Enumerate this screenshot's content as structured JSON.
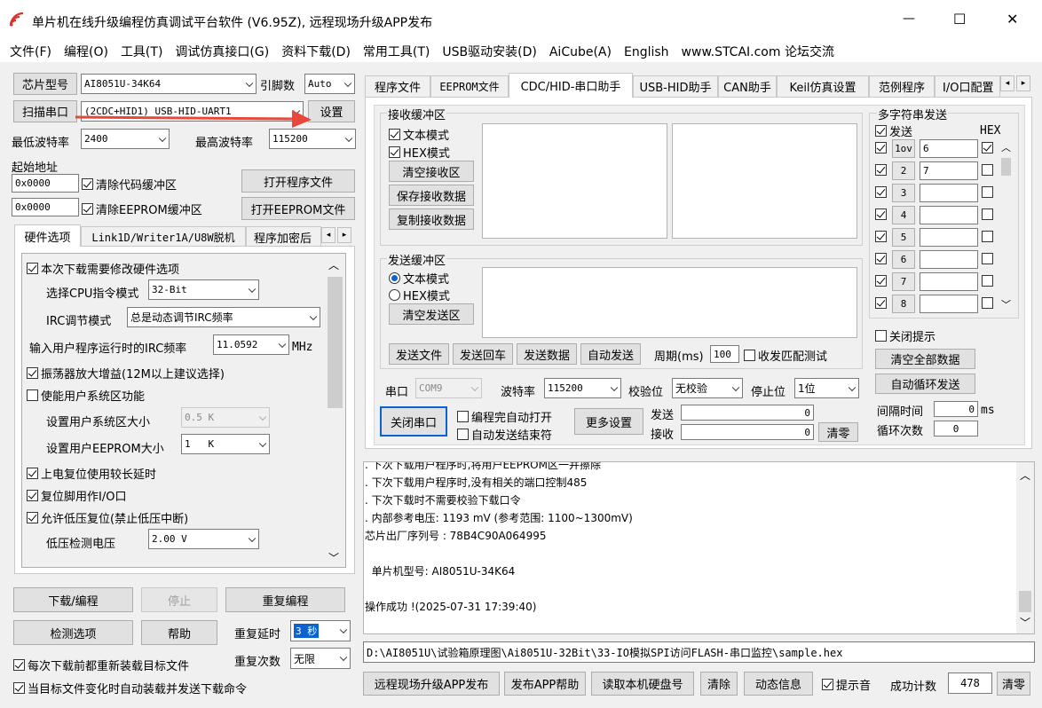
{
  "window": {
    "title": "单片机在线升级编程仿真调试平台软件 (V6.95Z), 远程现场升级APP发布",
    "minimize": "—",
    "maximize": "☐",
    "close": "✕"
  },
  "menu": [
    "文件(F)",
    "编程(O)",
    "工具(T)",
    "调试仿真接口(G)",
    "资料下载(D)",
    "常用工具(T)",
    "USB驱动安装(D)",
    "AiCube(A)",
    "English",
    "www.STCAI.com 论坛交流"
  ],
  "left": {
    "chip_btn": "芯片型号",
    "chip": "AI8051U-34K64",
    "pin_label": "引脚数",
    "pin": "Auto",
    "scan_btn": "扫描串口",
    "port": "(2CDC+HID1) USB-HID-UART1",
    "settings_btn": "设置",
    "min_baud_label": "最低波特率",
    "min_baud": "2400",
    "max_baud_label": "最高波特率",
    "max_baud": "115200",
    "start_addr_label": "起始地址",
    "addr1": "0x0000",
    "clear_code": "清除代码缓冲区",
    "open_prog": "打开程序文件",
    "addr2": "0x0000",
    "clear_eeprom": "清除EEPROM缓冲区",
    "open_eeprom": "打开EEPROM文件",
    "tabs": [
      "硬件选项",
      "Link1D/Writer1A/U8W脱机",
      "程序加密后"
    ],
    "hw": {
      "opt_modify": "本次下载需要修改硬件选项",
      "cpu_mode_label": "选择CPU指令模式",
      "cpu_mode": "32-Bit",
      "irc_mode_label": "IRC调节模式",
      "irc_mode": "总是动态调节IRC频率",
      "irc_freq_label": "输入用户程序运行时的IRC频率",
      "irc_freq": "11.0592",
      "mhz": "MHz",
      "osc_gain": "振荡器放大增益(12M以上建议选择)",
      "user_sys": "使能用户系统区功能",
      "sys_size_label": "设置用户系统区大小",
      "sys_size": "0.5 K",
      "eeprom_size_label": "设置用户EEPROM大小",
      "eeprom_size": "1   K",
      "power_delay": "上电复位使用较长延时",
      "reset_io": "复位脚用作I/O口",
      "lvr": "允许低压复位(禁止低压中断)",
      "lvd_label": "低压检测电压",
      "lvd": "2.00 V"
    },
    "download_btn": "下载/编程",
    "stop_btn": "停止",
    "reprog_btn": "重复编程",
    "check_btn": "检测选项",
    "help_btn": "帮助",
    "delay_label": "重复延时",
    "delay": "3 秒",
    "count_label": "重复次数",
    "count": "无限",
    "reload_each": "每次下载前都重新装载目标文件",
    "auto_reload": "当目标文件变化时自动装载并发送下载命令"
  },
  "right": {
    "tabs": [
      "程序文件",
      "EEPROM文件",
      "CDC/HID-串口助手",
      "USB-HID助手",
      "CAN助手",
      "Keil仿真设置",
      "范例程序",
      "I/O口配置"
    ],
    "rx_group": "接收缓冲区",
    "rx_text": "文本模式",
    "rx_hex": "HEX模式",
    "clear_rx": "清空接收区",
    "save_rx": "保存接收数据",
    "copy_rx": "复制接收数据",
    "tx_group": "发送缓冲区",
    "tx_text": "文本模式",
    "tx_hex": "HEX模式",
    "clear_tx": "清空发送区",
    "send_file": "发送文件",
    "send_enter": "发送回车",
    "send_data": "发送数据",
    "auto_send": "自动发送",
    "period_label": "周期(ms)",
    "period": "100",
    "match_test": "收发匹配测试",
    "port_label": "串口",
    "port": "COM9",
    "baud_label": "波特率",
    "baud": "115200",
    "parity_label": "校验位",
    "parity": "无校验",
    "stop_label": "停止位",
    "stop": "1位",
    "close_port": "关闭串口",
    "auto_open": "编程完自动打开",
    "auto_end": "自动发送结束符",
    "more": "更多设置",
    "tx_label": "发送",
    "tx_count": "0",
    "rx_label": "接收",
    "rx_count": "0",
    "clear_btn": "清零",
    "multi_group": "多字符串发送",
    "send_col": "发送",
    "hex_col": "HEX",
    "rows": [
      {
        "n": "1ov",
        "v": "6",
        "hex": true
      },
      {
        "n": "2",
        "v": "7",
        "hex": false
      },
      {
        "n": "3",
        "v": "",
        "hex": false
      },
      {
        "n": "4",
        "v": "",
        "hex": false
      },
      {
        "n": "5",
        "v": "",
        "hex": false
      },
      {
        "n": "6",
        "v": "",
        "hex": false
      },
      {
        "n": "7",
        "v": "",
        "hex": false
      },
      {
        "n": "8",
        "v": "",
        "hex": false
      }
    ],
    "close_tip": "关闭提示",
    "clear_all": "清空全部数据",
    "auto_loop": "自动循环发送",
    "interval_label": "间隔时间",
    "interval": "0",
    "ms": "ms",
    "loop_label": "循环次数",
    "loop": "0"
  },
  "log": [
    ". 下次下载用户程序时,将用户EEPROM区一并擦除",
    ". 下次下载用户程序时,没有相关的端口控制485",
    ". 下次下载时不需要校验下载口令",
    ". 内部参考电压: 1193 mV (参考范围: 1100~1300mV)",
    "芯片出厂序列号 : 78B4C90A064995",
    "",
    "  单片机型号: AI8051U-34K64",
    "",
    "操作成功 !(2025-07-31 17:39:40)"
  ],
  "filepath": "D:\\AI8051U\\试验箱原理图\\Ai8051U-32Bit\\33-IO模拟SPI访问FLASH-串口监控\\sample.hex",
  "bottom": {
    "remote": "远程现场升级APP发布",
    "publish_help": "发布APP帮助",
    "read_disk": "读取本机硬盘号",
    "clear": "清除",
    "dynamic": "动态信息",
    "beep": "提示音",
    "success_label": "成功计数",
    "success": "478",
    "clear2": "清零"
  },
  "colors": {
    "arrow": "#e8473a",
    "accent": "#0b62d0",
    "logo": "#d9332a"
  }
}
